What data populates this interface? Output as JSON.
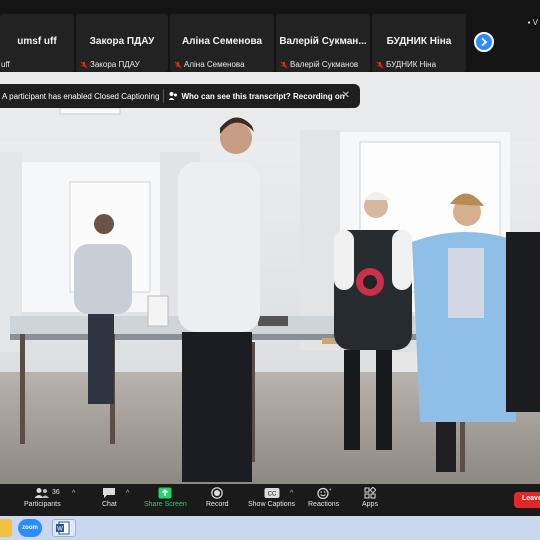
{
  "participants": [
    {
      "display": "umsf uff",
      "label": "uff"
    },
    {
      "display": "Закора ПДАУ",
      "label": "Закора ПДАУ"
    },
    {
      "display": "Аліна Семенова",
      "label": "Аліна Семенова"
    },
    {
      "display": "Валерій  Сукман...",
      "label": "Валерій Сукманов"
    },
    {
      "display": "БУДНИК Ніна",
      "label": "БУДНИК Ніна"
    }
  ],
  "view_mini": "V",
  "captions_notice": "A participant has enabled Closed Captioning",
  "transcript_link": "Who can see this transcript? Recording on",
  "toolbar": {
    "participants_label": "Participants",
    "participants_count": "36",
    "chat_label": "Chat",
    "share_label": "Share Screen",
    "record_label": "Record",
    "captions_label": "Show Captions",
    "reactions_label": "Reactions",
    "apps_label": "Apps",
    "leave_label": "Leave"
  },
  "taskbar": {
    "zoom_label": "zoom"
  },
  "colors": {
    "accent": "#2d8cff",
    "share_green": "#24d36a",
    "leave_red": "#e02828",
    "mic_muted": "#e02828"
  },
  "icons": [
    "microphone-muted-icon",
    "chevron-right-icon",
    "participants-icon",
    "chat-icon",
    "share-screen-icon",
    "record-icon",
    "captions-icon",
    "reactions-icon",
    "apps-icon",
    "close-icon",
    "transcript-icon"
  ]
}
